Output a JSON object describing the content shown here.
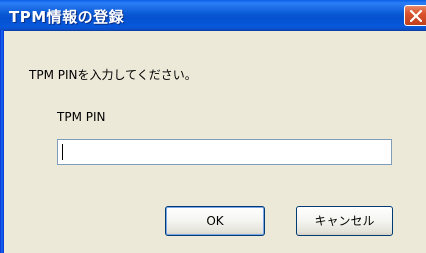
{
  "dialog": {
    "title": "TPM情報の登録",
    "prompt": "TPM PINを入力してください。",
    "field_label": "TPM PIN",
    "pin_value": "",
    "ok_label": "OK",
    "cancel_label": "キャンセル"
  },
  "colors": {
    "titlebar": "#0a5ad6",
    "close_button": "#d9532c",
    "window_background": "#ece9d8"
  },
  "icons": {
    "close": "close-icon"
  }
}
